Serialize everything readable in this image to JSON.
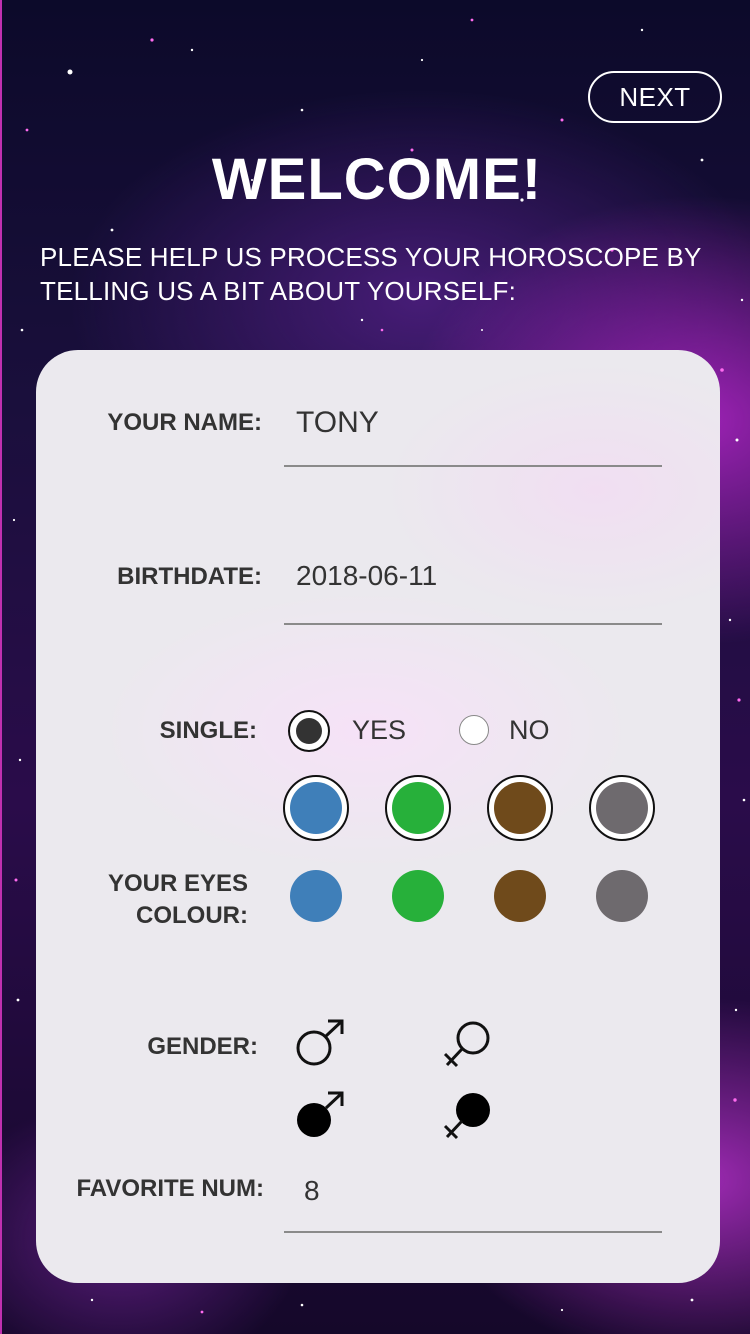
{
  "header": {
    "next_label": "NEXT",
    "title": "WELCOME!",
    "subtitle": "PLEASE HELP US PROCESS YOUR HOROSCOPE BY TELLING US A BIT ABOUT YOURSELF:"
  },
  "form": {
    "name": {
      "label": "YOUR NAME:",
      "value": "TONY"
    },
    "birthdate": {
      "label": "BIRTHDATE:",
      "value": "2018-06-11"
    },
    "single": {
      "label": "SINGLE:",
      "options": [
        "YES",
        "NO"
      ],
      "selected": "YES"
    },
    "eyes": {
      "label_line1": "YOUR EYES",
      "label_line2": "COLOUR:",
      "colors": [
        "#3f7fb9",
        "#27b03a",
        "#6f4a1b",
        "#6e6a6e"
      ],
      "color_names": [
        "blue",
        "green",
        "brown",
        "grey"
      ]
    },
    "gender": {
      "label": "GENDER:",
      "options": [
        "male",
        "female"
      ]
    },
    "favorite": {
      "label": "FAVORITE NUM:",
      "value": "8"
    }
  }
}
